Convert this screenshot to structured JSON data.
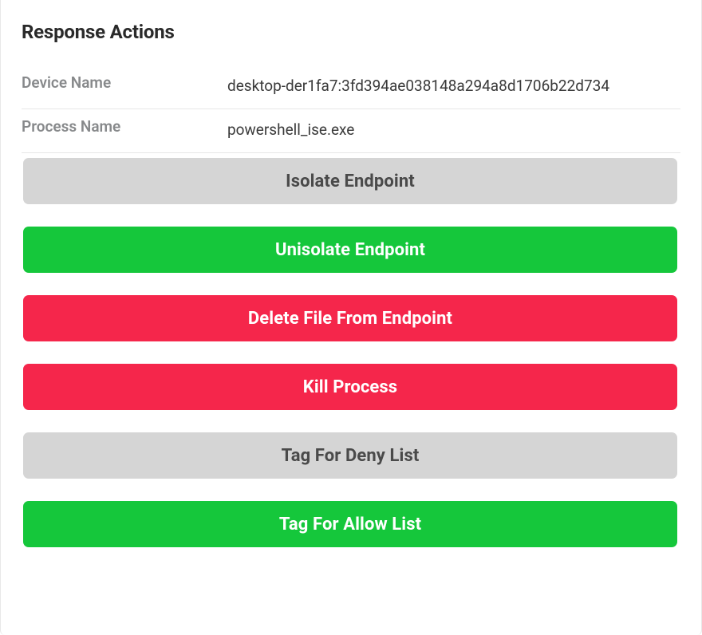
{
  "panel": {
    "title": "Response Actions"
  },
  "info": {
    "device_name_label": "Device Name",
    "device_name_value": "desktop-der1fa7:3fd394ae038148a294a8d1706b22d734",
    "process_name_label": "Process Name",
    "process_name_value": "powershell_ise.exe"
  },
  "actions": {
    "isolate": "Isolate Endpoint",
    "unisolate": "Unisolate Endpoint",
    "delete_file": "Delete File From Endpoint",
    "kill_process": "Kill Process",
    "tag_deny": "Tag For Deny List",
    "tag_allow": "Tag For Allow List"
  },
  "colors": {
    "muted_bg": "#d5d5d5",
    "muted_text": "#4a4a4a",
    "green": "#15c73b",
    "red": "#f5264b"
  }
}
